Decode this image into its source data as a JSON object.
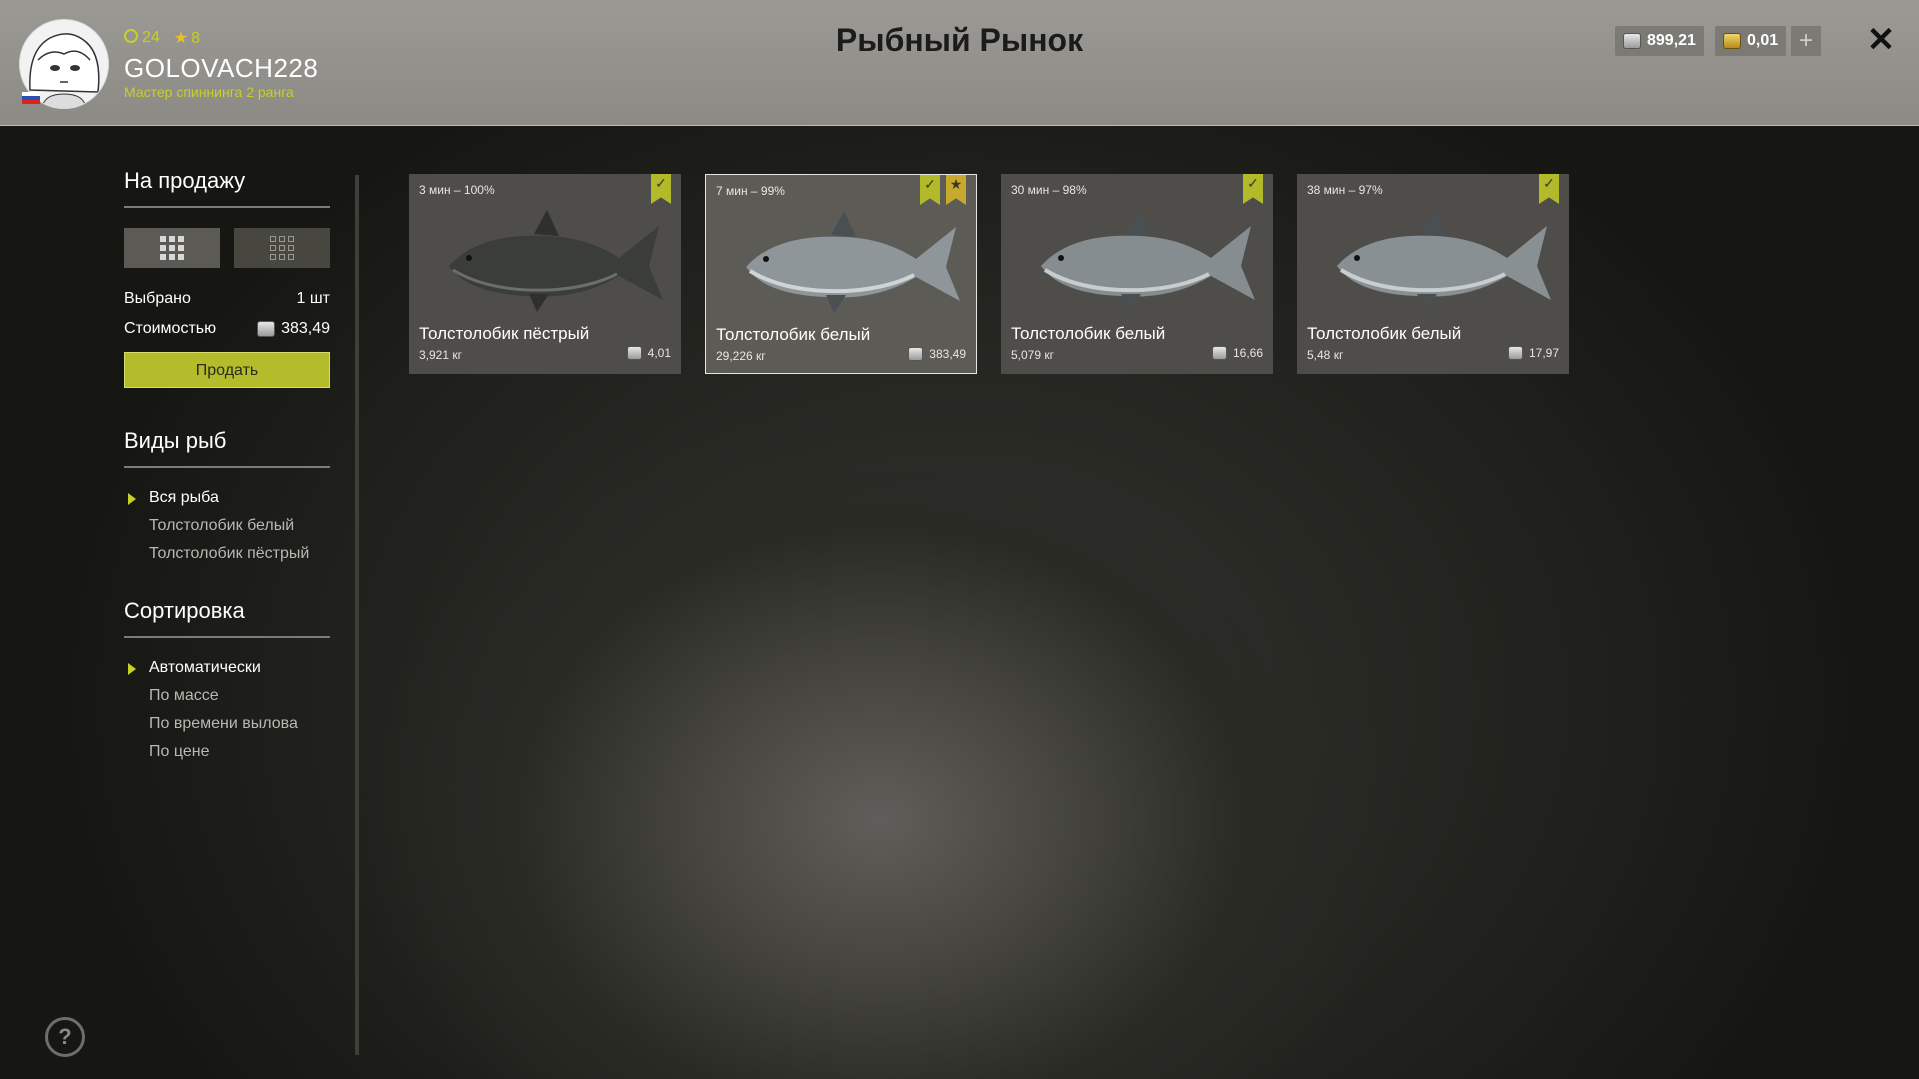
{
  "header": {
    "title": "Рыбный Рынок",
    "level": "24",
    "stars": "8",
    "username": "GOLOVACH228",
    "rank": "Мастер спиннинга 2 ранга",
    "silver": "899,21",
    "gold": "0,01"
  },
  "sidebar": {
    "sale_title": "На продажу",
    "selected_label": "Выбрано",
    "selected_value": "1 шт",
    "cost_label": "Стоимостью",
    "cost_value": "383,49",
    "sell_button": "Продать",
    "species_title": "Виды рыб",
    "species": [
      "Вся рыба",
      "Толстолобик белый",
      "Толстолобик пёстрый"
    ],
    "sort_title": "Сортировка",
    "sort": [
      "Автоматически",
      "По массе",
      "По времени вылова",
      "По цене"
    ]
  },
  "fish": [
    {
      "time": "3 мин – 100%",
      "name": "Толстолобик пёстрый",
      "weight": "3,921 кг",
      "price": "4,01"
    },
    {
      "time": "7 мин – 99%",
      "name": "Толстолобик белый",
      "weight": "29,226 кг",
      "price": "383,49"
    },
    {
      "time": "30 мин – 98%",
      "name": "Толстолобик белый",
      "weight": "5,079 кг",
      "price": "16,66"
    },
    {
      "time": "38 мин – 97%",
      "name": "Толстолобик белый",
      "weight": "5,48 кг",
      "price": "17,97"
    }
  ],
  "colors": {
    "accent": "#b4bc2c",
    "gold_bookmark": "#c7a92d"
  },
  "icons": [
    "check-icon",
    "star-icon",
    "close-icon",
    "plus-icon",
    "help-icon",
    "grid-icon",
    "silver-coin-icon",
    "gold-coin-icon"
  ]
}
